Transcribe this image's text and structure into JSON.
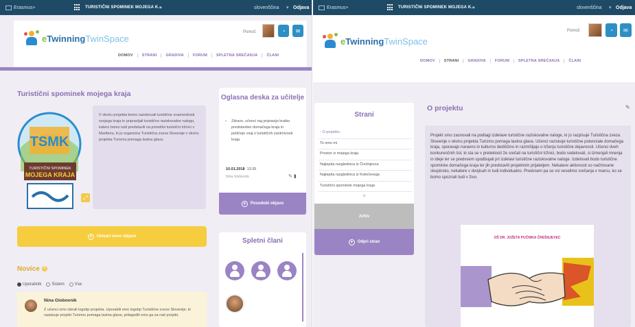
{
  "colors": {
    "accent": "#9b84c4",
    "title": "#8a6fb3",
    "topbar": "#1f4a66",
    "yellow": "#f6cd3e",
    "blue_button": "#2d8fc4"
  },
  "left": {
    "topbar": {
      "brand": "Erasmus+",
      "project": "TURISTIČNI SPOMINEK MOJEGA K...",
      "language": "slovenščina",
      "logout": "Odjava"
    },
    "logo": {
      "e": "e",
      "twinning": "Twinning",
      "twinspace": "TwinSpace"
    },
    "header": {
      "help": "Pomoč"
    },
    "nav": [
      "DOMOV",
      "STRANI",
      "GRADIVA",
      "FORUM",
      "SPLETNA SREČANJA",
      "ČLANI"
    ],
    "project_title": "Turistični spominek mojega kraja",
    "badge": {
      "text1": "TURISTIČNI SPOMINEK",
      "text2": "MOJEGA KRAJA"
    },
    "description": "V okviru projekta bomo raziskovali turistične znamenitosti svojega kraja in pripravljali turistično raziskovalno nalogo, katero bomo tudi predstavili na prireditvi turistični tržnici v Mariboru, ki jo organizira Turistična zveza Slovenije v okviru projekta Turizmu pomaga lastna glava.",
    "new_post_button": "Ustvari novo objavo",
    "news": {
      "title": "Novice",
      "filters": [
        {
          "label": "Uporabnik",
          "selected": true
        },
        {
          "label": "Sistem",
          "selected": false
        },
        {
          "label": "Vse",
          "selected": false
        }
      ],
      "post": {
        "author": "Nina Globovnik",
        "text": "Z učenci smo izbrali logotip projekta. Uporabili smo logotip Turistične zveze Slovenije, ki razpisuje projekt Turizmu pomaga lastna glava, prilagodili smo ga za naš projekt."
      }
    },
    "board": {
      "title": "Oglasna deska za učitelje",
      "body": "Zdravo, učenci naj pripravijo kratko predstavitev domačega kraja in poiščejo vsaj z turističnih zanimivosti kraja.",
      "date": "10.01.2018",
      "time": "13:35",
      "author": "Nina Globovnik",
      "button": "Posodobi objavo"
    },
    "members": {
      "title": "Spletni člani"
    }
  },
  "right": {
    "topbar": {
      "brand": "Erasmus+",
      "project": "TURISTIČNI SPOMINEK MOJEGA K...",
      "language": "slovenščina",
      "logout": "Odjava"
    },
    "logo": {
      "e": "e",
      "twinning": "Twinning",
      "twinspace": "TwinSpace"
    },
    "header": {
      "help": "Pomoč"
    },
    "nav": [
      "DOMOV",
      "STRANI",
      "GRADIVA",
      "FORUM",
      "SPLETNA SREČANJA",
      "ČLANI"
    ],
    "pages": {
      "title": "Strani",
      "items": [
        "O projektu",
        "To smo mi",
        "Prostor iz mojega kraja",
        "Najlepša razglednica iz Črešnjevca",
        "Najlepša razglednica iz Koločevega",
        "Turistični spominek mojega kraja"
      ],
      "archive": "Arhiv",
      "open_page": "Odpri stran"
    },
    "about": {
      "title": "O projektu",
      "text": "Projekt smo zasnovali na podlagi izdelave turistične raziskovalne naloge, ki jo razpisuje Turistična zveza Slovenije v okviru projekta Turizmu pomaga lastna glava. Učenci raziskuje turistične potenciale domačega kraja, sporavajo naravno in kulturno dediščino in razmišljajo o trženju turistične dejavnosti. Učenci dveh konkurenčnih šol, ki sta se v preteklosti že srečali na turistični tržnici, bodo sodelovali, si izmenjali mnenja in ideje ter se predvsem spodbujali pri izdelavi turistične raziskovalne naloge. Izdelovali bodo turistične spominke domačega kraja ter jih predstavili projektnim prijateljem. Nekatere aktivnosti so načrtovane skupinsko, nekatere v dvojicah in tudi individualno. Predvsem pa se vsi veselimo srečanja v marcu, ko se bomo spoznali tudi v živo.",
      "image_caption": "OŠ DR. JOŽETA PUČNIKA ČREŠNJEVEC"
    }
  }
}
